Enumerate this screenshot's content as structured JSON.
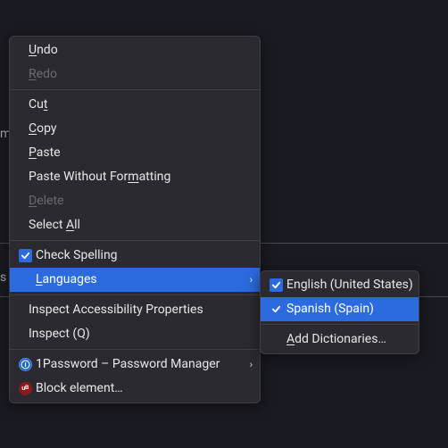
{
  "background": {
    "frag1": "m",
    "frag2": "s"
  },
  "menu": {
    "undo": "<u>U</u>ndo",
    "redo": "<u>R</u>edo",
    "cut": "Cu<u>t</u>",
    "copy": "<u>C</u>opy",
    "paste": "<u>P</u>aste",
    "paste_plain": "Paste Without For<u>m</u>atting",
    "delete": "<u>D</u>elete",
    "select_all": "Select <u>A</u>ll",
    "check_spelling": "Check Spelling",
    "languages": "<u>L</u>anguages",
    "inspect_a11y": "Inspect Accessibility Properties",
    "inspect": "Inspect (Q)",
    "ext_1password": "1Password – Password Manager",
    "ext_ublock": "Block element…"
  },
  "submenu": {
    "en_us": "English (United States)",
    "es_es": "Spanish (Spain)",
    "add_dicts": "<u>A</u>dd Dictionaries…"
  },
  "icons": {
    "checkmark": "check-icon",
    "submenu_arrow": "›",
    "onepassword_glyph": "ⓘ",
    "ublock_glyph": "uʙ"
  }
}
